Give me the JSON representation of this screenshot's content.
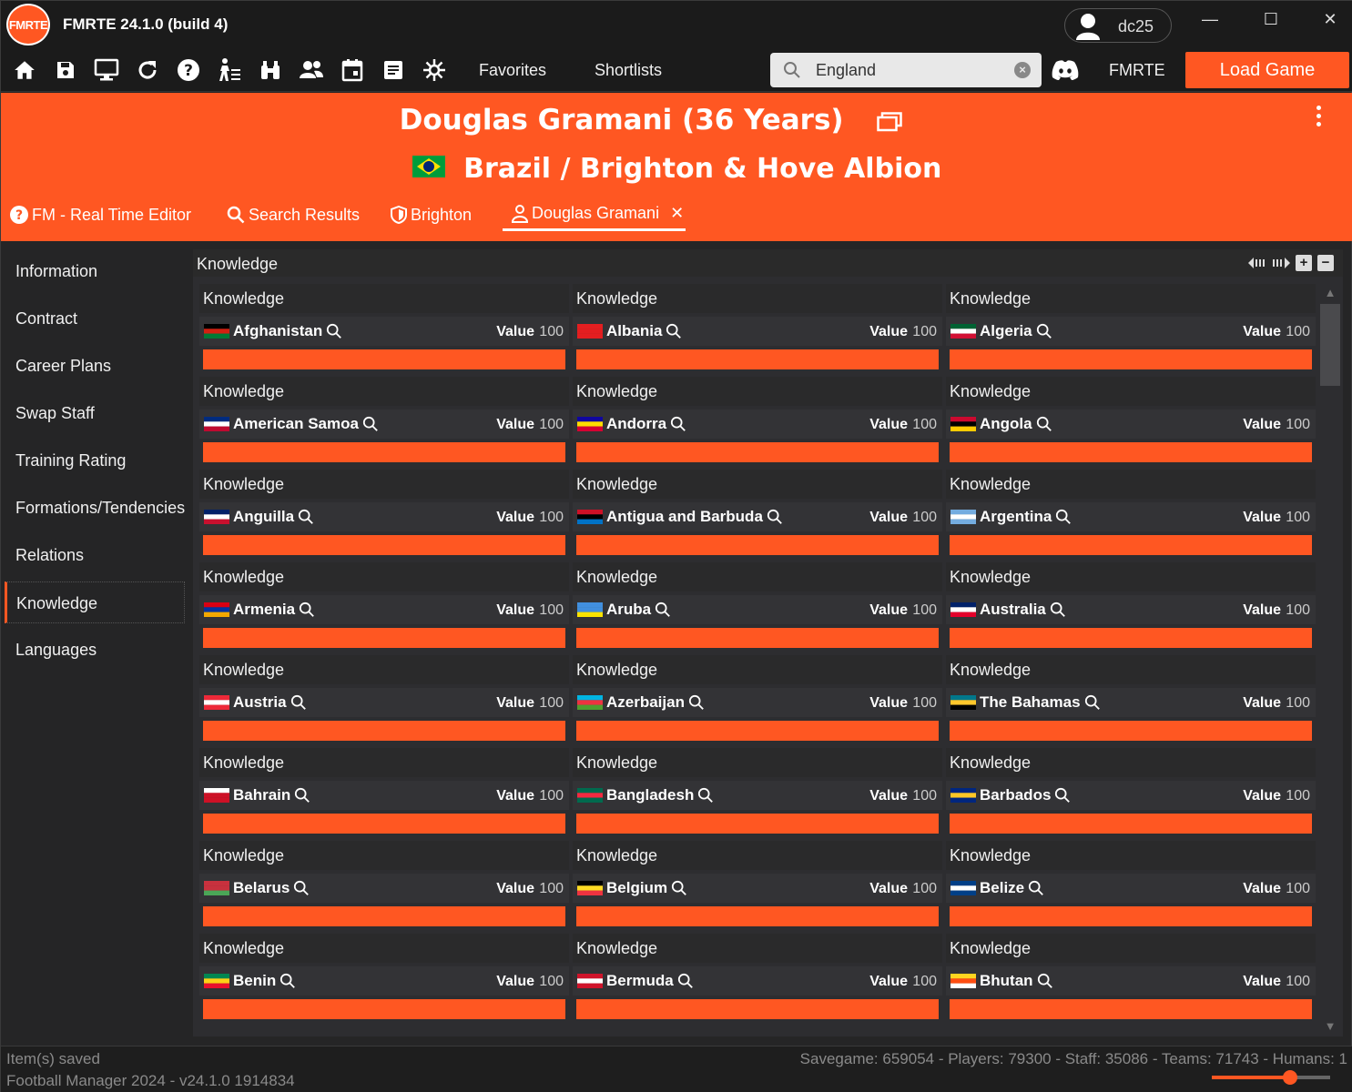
{
  "app": {
    "title": "FMRTE 24.1.0 (build 4)",
    "logo_text": "FMRTE",
    "username": "dc25"
  },
  "window_controls": {
    "minimize": "—",
    "maximize": "☐",
    "close": "✕"
  },
  "toolbar": {
    "icons": [
      "home-icon",
      "save-icon",
      "monitor-icon",
      "refresh-icon",
      "help-icon",
      "player-icon",
      "binoculars-icon",
      "people-icon",
      "calendar-icon",
      "notes-icon",
      "gear-icon"
    ],
    "favorites_label": "Favorites",
    "shortlists_label": "Shortlists",
    "search": {
      "value": "England",
      "placeholder": ""
    },
    "fmrte_label": "FMRTE",
    "load_game_label": "Load Game"
  },
  "header": {
    "player_title": "Douglas Gramani (36 Years)",
    "subtitle": "Brazil / Brighton & Hove Albion",
    "tabs": [
      {
        "label": "FM - Real Time Editor",
        "icon": "help-icon"
      },
      {
        "label": "Search Results",
        "icon": "search-icon"
      },
      {
        "label": "Brighton",
        "icon": "shield-icon"
      },
      {
        "label": "Douglas Gramani",
        "icon": "person-icon",
        "closable": true
      }
    ]
  },
  "sidebar": {
    "items": [
      "Information",
      "Contract",
      "Career Plans",
      "Swap Staff",
      "Training Rating",
      "Formations/Tendencies",
      "Relations",
      "Knowledge",
      "Languages"
    ],
    "active": "Knowledge"
  },
  "main": {
    "title": "Knowledge",
    "card_title": "Knowledge",
    "value_label": "Value",
    "max_value": 100,
    "cards": [
      {
        "country": "Afghanistan",
        "value": 100,
        "flag": [
          "#000000",
          "#d32011",
          "#007a36"
        ]
      },
      {
        "country": "Albania",
        "value": 100,
        "flag": [
          "#e41e20",
          "#e41e20",
          "#e41e20"
        ]
      },
      {
        "country": "Algeria",
        "value": 100,
        "flag": [
          "#006233",
          "#ffffff",
          "#d21034"
        ]
      },
      {
        "country": "American Samoa",
        "value": 100,
        "flag": [
          "#002b7f",
          "#ffffff",
          "#bf0a30"
        ]
      },
      {
        "country": "Andorra",
        "value": 100,
        "flag": [
          "#10069f",
          "#fedd00",
          "#d50032"
        ]
      },
      {
        "country": "Angola",
        "value": 100,
        "flag": [
          "#cc092f",
          "#000000",
          "#ffcb00"
        ]
      },
      {
        "country": "Anguilla",
        "value": 100,
        "flag": [
          "#012169",
          "#ffffff",
          "#c8102e"
        ]
      },
      {
        "country": "Antigua and Barbuda",
        "value": 100,
        "flag": [
          "#ce1126",
          "#000000",
          "#0072c6"
        ]
      },
      {
        "country": "Argentina",
        "value": 100,
        "flag": [
          "#74acdf",
          "#ffffff",
          "#74acdf"
        ]
      },
      {
        "country": "Armenia",
        "value": 100,
        "flag": [
          "#d90012",
          "#0033a0",
          "#f2a800"
        ]
      },
      {
        "country": "Aruba",
        "value": 100,
        "flag": [
          "#418fde",
          "#418fde",
          "#f9e300"
        ]
      },
      {
        "country": "Australia",
        "value": 100,
        "flag": [
          "#012169",
          "#ffffff",
          "#e4002b"
        ]
      },
      {
        "country": "Austria",
        "value": 100,
        "flag": [
          "#ed2939",
          "#ffffff",
          "#ed2939"
        ]
      },
      {
        "country": "Azerbaijan",
        "value": 100,
        "flag": [
          "#00b5e2",
          "#ef3340",
          "#509e2f"
        ]
      },
      {
        "country": "The Bahamas",
        "value": 100,
        "flag": [
          "#00778b",
          "#ffc72c",
          "#000000"
        ]
      },
      {
        "country": "Bahrain",
        "value": 100,
        "flag": [
          "#ffffff",
          "#ce1126",
          "#ce1126"
        ]
      },
      {
        "country": "Bangladesh",
        "value": 100,
        "flag": [
          "#006a4e",
          "#f42a41",
          "#006a4e"
        ]
      },
      {
        "country": "Barbados",
        "value": 100,
        "flag": [
          "#00267f",
          "#ffc726",
          "#00267f"
        ]
      },
      {
        "country": "Belarus",
        "value": 100,
        "flag": [
          "#c8313e",
          "#c8313e",
          "#4aa657"
        ]
      },
      {
        "country": "Belgium",
        "value": 100,
        "flag": [
          "#000000",
          "#fdda24",
          "#ef3340"
        ]
      },
      {
        "country": "Belize",
        "value": 100,
        "flag": [
          "#003f87",
          "#ffffff",
          "#003f87"
        ]
      },
      {
        "country": "Benin",
        "value": 100,
        "flag": [
          "#008751",
          "#fcd116",
          "#e8112d"
        ]
      },
      {
        "country": "Bermuda",
        "value": 100,
        "flag": [
          "#cf142b",
          "#ffffff",
          "#cf142b"
        ]
      },
      {
        "country": "Bhutan",
        "value": 100,
        "flag": [
          "#ffd520",
          "#ff4e12",
          "#ffffff"
        ]
      }
    ]
  },
  "status": {
    "line1": "Item(s) saved",
    "line2": "Football Manager 2024 - v24.1.0 1914834",
    "right": "Savegame: 659054 - Players: 79300 - Staff: 35086 - Teams: 71743 - Humans: 1",
    "zoom_level": 0.66
  },
  "colors": {
    "accent": "#ff5722",
    "background": "#252526",
    "panel": "#2d2d30"
  }
}
